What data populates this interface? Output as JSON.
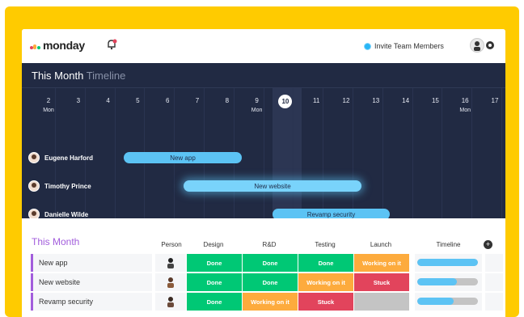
{
  "header": {
    "logo_text": "monday",
    "invite_label": "Invite Team Members"
  },
  "timeline": {
    "title_main": "This Month",
    "title_sub": "Timeline",
    "days": [
      "2",
      "3",
      "4",
      "5",
      "6",
      "7",
      "8",
      "9",
      "10",
      "11",
      "12",
      "13",
      "14",
      "15",
      "16",
      "17"
    ],
    "mon_label": "Mon",
    "today": "10",
    "people": [
      {
        "name": "Eugene Harford",
        "task": "New app"
      },
      {
        "name": "Timothy Prince",
        "task": "New website"
      },
      {
        "name": "Danielle Wilde",
        "task": "Revamp security"
      }
    ]
  },
  "table": {
    "group_title": "This Month",
    "columns": [
      "Person",
      "Design",
      "R&D",
      "Testing",
      "Launch",
      "Timeline"
    ],
    "rows": [
      {
        "name": "New app",
        "design": "Done",
        "rnd": "Done",
        "testing": "Done",
        "launch": "Working on it",
        "timeline_progress": 1.0
      },
      {
        "name": "New website",
        "design": "Done",
        "rnd": "Done",
        "testing": "Working on it",
        "launch": "Stuck",
        "timeline_progress": 0.65
      },
      {
        "name": "Revamp security",
        "design": "Done",
        "rnd": "Working on it",
        "testing": "Stuck",
        "launch": "",
        "timeline_progress": 0.6
      }
    ]
  },
  "colors": {
    "done": "#00c875",
    "working": "#fdab3d",
    "stuck": "#e2445c",
    "accent": "#a25ddc",
    "timeline_bar": "#5cc3f4",
    "brand_yellow": "#ffcb00"
  }
}
